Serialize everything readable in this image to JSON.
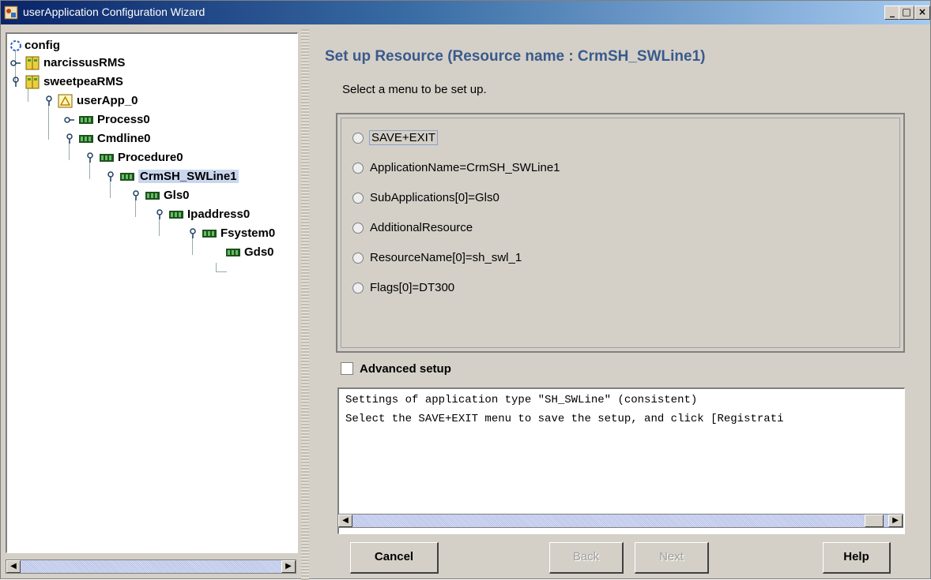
{
  "window": {
    "title": "userApplication Configuration Wizard",
    "min_glyph": "_",
    "max_glyph": "□",
    "close_glyph": "×"
  },
  "tree": {
    "items": [
      {
        "label": "config",
        "icon": "config-icon"
      },
      {
        "label": "narcissusRMS",
        "icon": "host-icon"
      },
      {
        "label": "sweetpeaRMS",
        "icon": "host-icon"
      },
      {
        "label": "userApp_0",
        "icon": "userapp-icon"
      },
      {
        "label": "Process0",
        "icon": "resource-icon"
      },
      {
        "label": "Cmdline0",
        "icon": "resource-icon"
      },
      {
        "label": "Procedure0",
        "icon": "resource-icon"
      },
      {
        "label": "CrmSH_SWLine1",
        "icon": "resource-icon",
        "selected": true
      },
      {
        "label": "Gls0",
        "icon": "resource-icon"
      },
      {
        "label": "Ipaddress0",
        "icon": "resource-icon"
      },
      {
        "label": "Fsystem0",
        "icon": "resource-icon"
      },
      {
        "label": "Gds0",
        "icon": "resource-icon"
      }
    ]
  },
  "main": {
    "heading": "Set up Resource (Resource name : CrmSH_SWLine1)",
    "subheading": "Select a menu to be set up.",
    "menu_options": [
      "SAVE+EXIT",
      "ApplicationName=CrmSH_SWLine1",
      "SubApplications[0]=Gls0",
      "AdditionalResource",
      "ResourceName[0]=sh_swl_1",
      "Flags[0]=DT300"
    ],
    "advanced_label": "Advanced setup",
    "advanced_checked": false,
    "info_lines": [
      "Settings of application type \"SH_SWLine\" (consistent)",
      "Select the SAVE+EXIT menu to save the setup, and click [Registrati"
    ]
  },
  "buttons": {
    "cancel": "Cancel",
    "back": "Back",
    "next": "Next",
    "help": "Help"
  },
  "colors": {
    "heading": "#3a5a8c",
    "selection": "#c9d6ee",
    "title_bar": "#0a246a"
  }
}
